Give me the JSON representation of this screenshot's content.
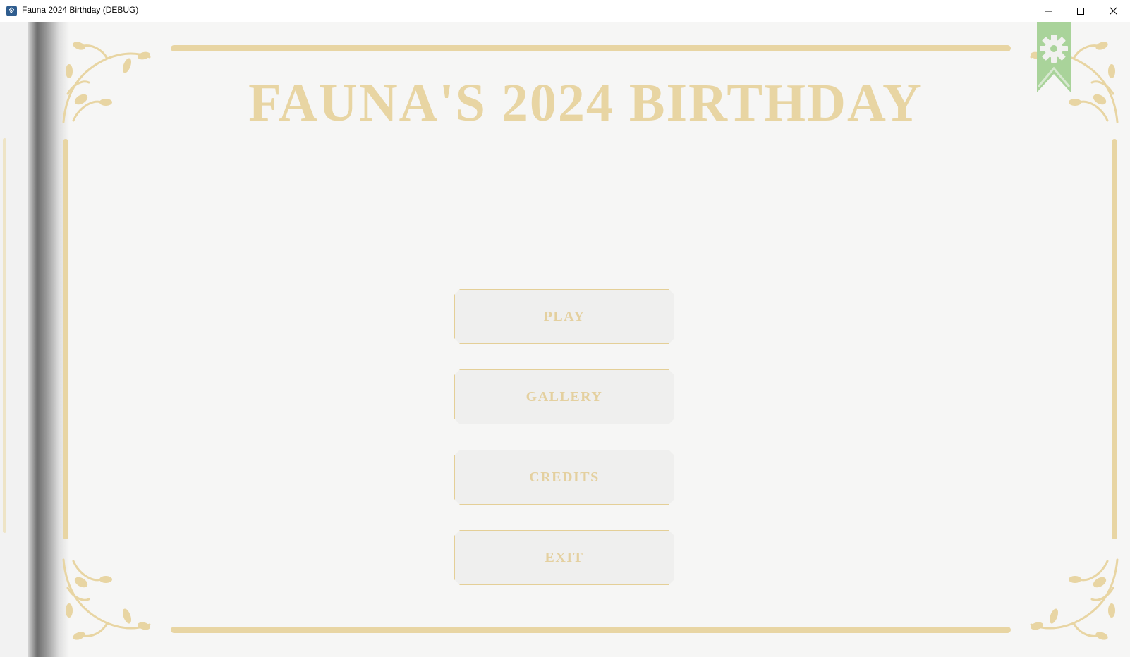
{
  "window": {
    "title": "Fauna 2024 Birthday (DEBUG)",
    "controls": [
      "minimize",
      "maximize",
      "close"
    ]
  },
  "game": {
    "title": "FAUNA'S 2024 BIRTHDAY",
    "menu": {
      "play": "PLAY",
      "gallery": "GALLERY",
      "credits": "CREDITS",
      "exit": "EXIT"
    },
    "settings_icon": "gear-icon"
  },
  "colors": {
    "gold": "#e8d5a3",
    "ribbon_green": "#a9d39a",
    "paper": "#f6f6f5",
    "button_bg": "#efefee"
  }
}
